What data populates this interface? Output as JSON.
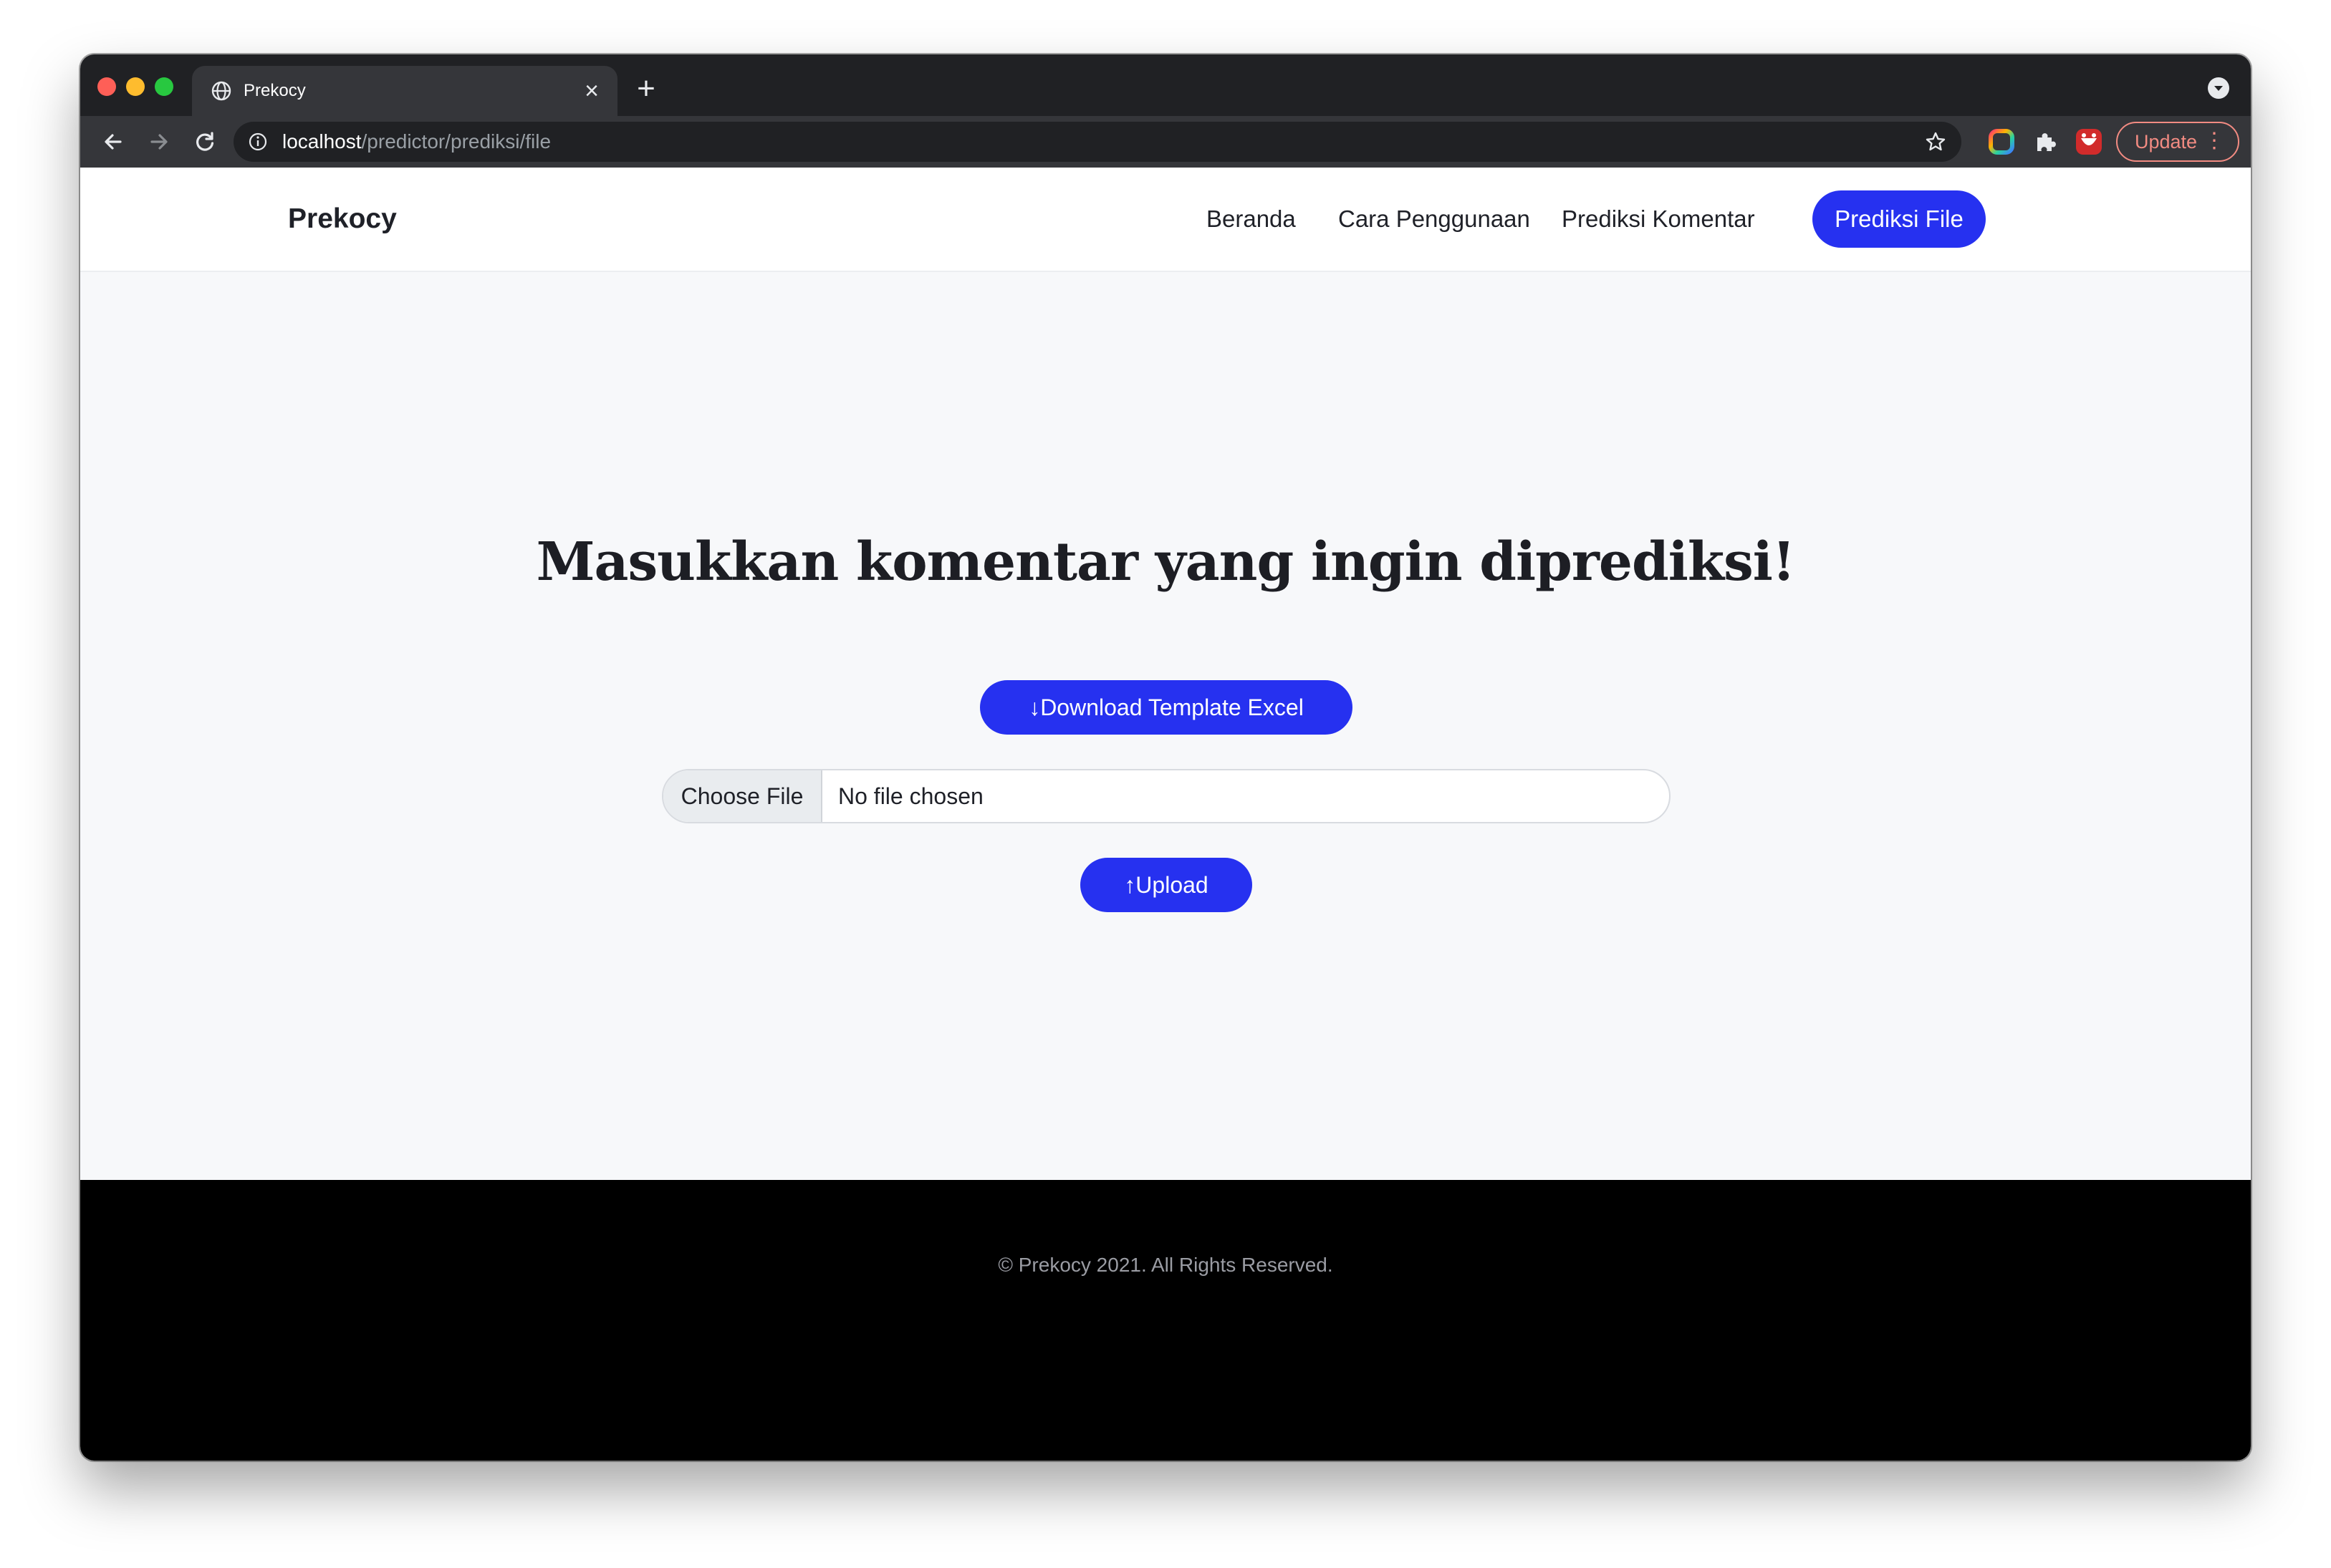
{
  "browser": {
    "tab": {
      "title": "Prekocy",
      "close_glyph": "×"
    },
    "new_tab_glyph": "+",
    "address": {
      "host": "localhost",
      "path": "/predictor/prediksi/file"
    },
    "update_label": "Update",
    "update_menu_glyph": "⋮",
    "icons": [
      "globe-icon",
      "close-icon",
      "plus-icon",
      "tab-search-icon",
      "back-icon",
      "forward-icon",
      "reload-icon",
      "site-info-icon",
      "star-icon",
      "color-extension-icon",
      "puzzle-extension-icon",
      "red-extension-icon"
    ]
  },
  "navbar": {
    "brand": "Prekocy",
    "links": [
      "Beranda",
      "Cara Penggunaan",
      "Prediksi Komentar"
    ],
    "active": "Prediksi File"
  },
  "main": {
    "heading": "Masukkan komentar yang ingin diprediksi!",
    "download_label": "↓Download Template Excel",
    "file_input": {
      "button": "Choose File",
      "status": "No file chosen"
    },
    "upload_label": "↑Upload"
  },
  "footer": {
    "text": "© Prekocy 2021. All Rights Reserved."
  },
  "colors": {
    "accent": "#2631f0",
    "page_bg": "#f7f8fa",
    "footer_bg": "#000000",
    "browser_dark": "#202124",
    "update_outline": "#f28b82"
  }
}
